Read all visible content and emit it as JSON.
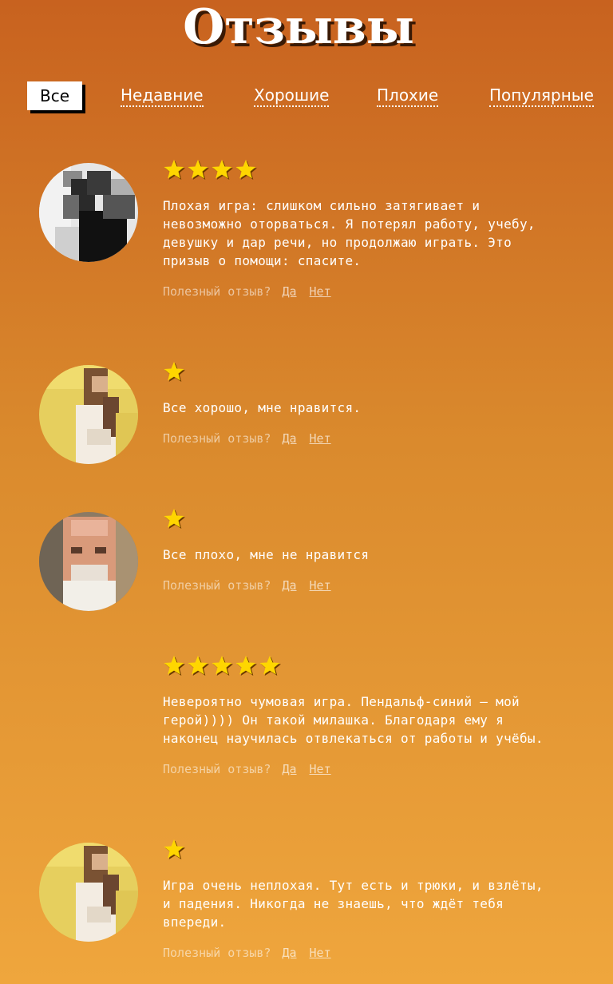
{
  "page": {
    "title": "Отзывы"
  },
  "tabs": [
    {
      "label": "Все",
      "active": true
    },
    {
      "label": "Недавние",
      "active": false
    },
    {
      "label": "Хорошие",
      "active": false
    },
    {
      "label": "Плохие",
      "active": false
    },
    {
      "label": "Популярные",
      "active": false
    }
  ],
  "reviews": [
    {
      "rating": 4,
      "avatar": "avatar-bw-man",
      "text": "Плохая игра: слишком сильно затягивает и\nневозможно оторваться. Я потерял работу, учебу,\nдевушку и дар речи, но продолжаю играть. Это\nпризыв о помощи: спасите.",
      "helpful_question": "Полезный отзыв?",
      "yes": "Да",
      "no": "Нет"
    },
    {
      "rating": 1,
      "avatar": "avatar-woman-yellow",
      "text": "Все хорошо, мне нравится.",
      "helpful_question": "Полезный отзыв?",
      "yes": "Да",
      "no": "Нет"
    },
    {
      "rating": 1,
      "avatar": "avatar-bald-man",
      "text": "Все плохо, мне не нравится",
      "helpful_question": "Полезный отзыв?",
      "yes": "Да",
      "no": "Нет"
    },
    {
      "rating": 5,
      "avatar": "none",
      "text": "Невероятно чумовая игра. Пендальф-синий — мой\nгерой)))) Он такой милашка. Благодаря ему я\nнаконец научилась отвлекаться от работы и учёбы.",
      "helpful_question": "Полезный отзыв?",
      "yes": "Да",
      "no": "Нет"
    },
    {
      "rating": 1,
      "avatar": "avatar-woman-yellow",
      "text": "Игра очень неплохая. Тут есть и трюки, и взлёты,\nи падения. Никогда не знаешь, что ждёт тебя\nвпереди.",
      "helpful_question": "Полезный отзыв?",
      "yes": "Да",
      "no": "Нет"
    }
  ],
  "colors": {
    "star": "#ffd600",
    "star_shadow": "#6b3a00",
    "accent": "#ffffff"
  }
}
